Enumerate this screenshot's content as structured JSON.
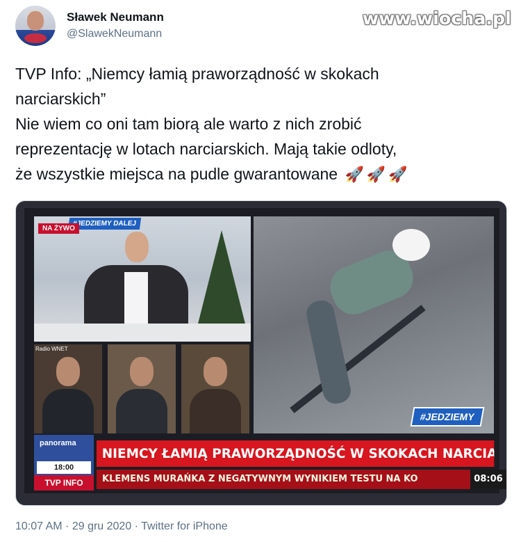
{
  "watermark": "www.wiocha.pl",
  "author": {
    "display_name": "Sławek Neumann",
    "handle": "@SlawekNeumann",
    "avatar_icon": "profile-photo-icon"
  },
  "tweet": {
    "lines": [
      "TVP Info: „Niemcy łamią praworządność w skokach",
      "narciarskich”",
      "Nie wiem co oni tam biorą ale warto z nich zrobić",
      "reprezentację w lotach narciarskich. Mają takie odloty,",
      "że wszystkie miejsca na pudle gwarantowane"
    ],
    "emoji": [
      "🚀",
      "🚀",
      "🚀"
    ]
  },
  "media": {
    "live_label": "NA ŻYWO",
    "show_label": "#JEDZIEMY DALEJ",
    "guest_label": "Radio WNET",
    "hashtag": "#JEDZIEMY",
    "channel_name": "panorama",
    "channel_time": "18:00",
    "logo": "TVP INFO",
    "headline": "NIEMCY ŁAMIĄ PRAWORZĄDNOŚĆ W SKOKACH NARCIARSKICH",
    "ticker": "KLEMENS MURAŃKA Z NEGATYWNYM WYNIKIEM TESTU NA KO",
    "clock": "08:06"
  },
  "meta": {
    "footer": "10:07 AM · 29 gru 2020 · Twitter for iPhone"
  }
}
